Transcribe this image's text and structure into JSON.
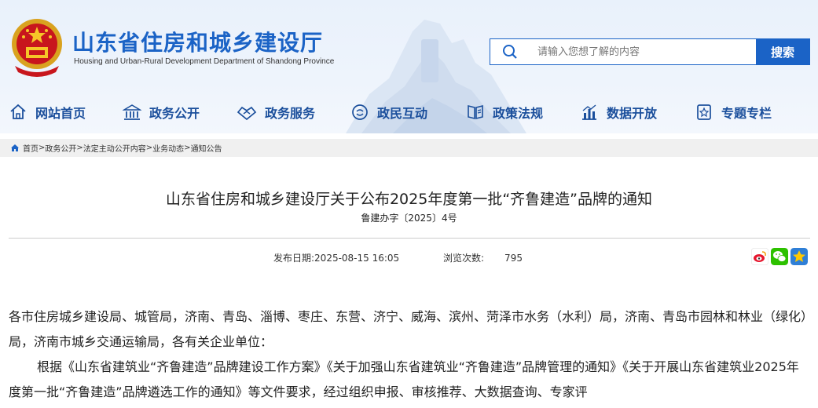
{
  "header": {
    "title": "山东省住房和城乡建设厅",
    "subtitle": "Housing and Urban-Rural Development Department of Shandong Province",
    "search_placeholder": "请输入您想了解的内容",
    "search_button": "搜索",
    "accent": "#1b63c6"
  },
  "nav": {
    "items": [
      {
        "label": "网站首页",
        "icon": "home-icon"
      },
      {
        "label": "政务公开",
        "icon": "building-icon"
      },
      {
        "label": "政务服务",
        "icon": "handshake-icon"
      },
      {
        "label": "政民互动",
        "icon": "interaction-icon"
      },
      {
        "label": "政策法规",
        "icon": "book-icon"
      },
      {
        "label": "数据开放",
        "icon": "chart-icon"
      },
      {
        "label": "专题专栏",
        "icon": "topic-icon"
      }
    ]
  },
  "breadcrumb": {
    "items": [
      "首页",
      "政务公开",
      "法定主动公开内容",
      "业务动态",
      "通知公告"
    ],
    "separator": ">"
  },
  "article": {
    "title": "山东省住房和城乡建设厅关于公布2025年度第一批“齐鲁建造”品牌的通知",
    "doc_number": "鲁建办字〔2025〕4号",
    "publish_label": "发布日期:",
    "publish_date": "2025-08-15 16:05",
    "views_label": "浏览次数:",
    "views": "795",
    "share_icons": [
      "weibo-icon",
      "wechat-icon",
      "favorite-icon"
    ],
    "paragraphs": [
      "各市住房城乡建设局、城管局，济南、青岛、淄博、枣庄、东营、济宁、威海、滨州、菏泽市水务（水利）局，济南、青岛市园林和林业（绿化）局，济南市城乡交通运输局，各有关企业单位：",
      "根据《山东省建筑业“齐鲁建造”品牌建设工作方案》《关于加强山东省建筑业“齐鲁建造”品牌管理的通知》《关于开展山东省建筑业2025年度第一批“齐鲁建造”品牌遴选工作的通知》等文件要求，经过组织申报、审核推荐、大数据查询、专家评"
    ]
  }
}
